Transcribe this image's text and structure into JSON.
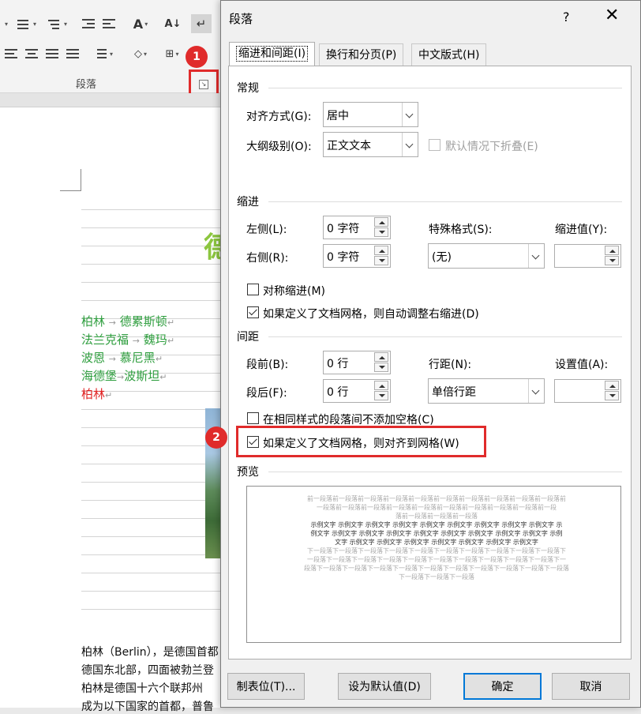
{
  "ribbon": {
    "group_label": "段落",
    "launcher_glyph": "↘",
    "icons": [
      "bullets-icon",
      "numbering-icon",
      "multilevel-list-icon",
      "decrease-indent-icon",
      "increase-indent-icon",
      "chinese-layout-icon",
      "sort-icon",
      "show-marks-icon",
      "align-left-icon",
      "align-center-icon",
      "align-right-icon",
      "justify-icon",
      "distributed-icon",
      "line-spacing-icon",
      "shading-icon",
      "borders-icon"
    ]
  },
  "callouts": {
    "one": "1",
    "two": "2"
  },
  "document": {
    "title_fragment": "德",
    "lines": [
      {
        "a": "柏林",
        "b": "德累斯顿",
        "color": "green"
      },
      {
        "a": "法兰克福",
        "b": "魏玛",
        "color": "green"
      },
      {
        "a": "波恩",
        "b": "慕尼黑",
        "color": "green"
      },
      {
        "a": "海德堡",
        "b": "波斯坦",
        "color": "green"
      },
      {
        "a": "柏林",
        "b": "",
        "color": "red"
      }
    ],
    "para_marker": "↵",
    "arrow": "→",
    "body_lines": [
      "柏林（Berlin），是德国首都",
      "德国东北部，四面被勃兰登",
      "柏林是德国十六个联邦州",
      "成为以下国家的首都，普鲁"
    ]
  },
  "dialog": {
    "title": "段落",
    "help": "?",
    "close": "✕",
    "tabs": [
      "缩进和间距(I)",
      "换行和分页(P)",
      "中文版式(H)"
    ],
    "general": {
      "heading": "常规",
      "alignment_label": "对齐方式(G):",
      "alignment_value": "居中",
      "outline_label": "大纲级别(O):",
      "outline_value": "正文文本",
      "collapse_label": "默认情况下折叠(E)"
    },
    "indent": {
      "heading": "缩进",
      "left_label": "左侧(L):",
      "left_value": "0 字符",
      "right_label": "右侧(R):",
      "right_value": "0 字符",
      "special_label": "特殊格式(S):",
      "special_value": "(无)",
      "by_label": "缩进值(Y):",
      "by_value": "",
      "mirror_label": "对称缩进(M)",
      "auto_adjust_label": "如果定义了文档网格，则自动调整右缩进(D)"
    },
    "spacing": {
      "heading": "间距",
      "before_label": "段前(B):",
      "before_value": "0 行",
      "after_label": "段后(F):",
      "after_value": "0 行",
      "line_label": "行距(N):",
      "line_value": "单倍行距",
      "at_label": "设置值(A):",
      "at_value": "",
      "no_space_label": "在相同样式的段落间不添加空格(C)",
      "snap_grid_label": "如果定义了文档网格，则对齐到网格(W)"
    },
    "preview": {
      "heading": "预览",
      "prev_lines": [
        "前一段落前一段落前一段落前一段落前一段落前一段落前一段落前一段落前一段落前一段落前",
        "一段落前一段落前一段落前一段落前一段落前一段落前一段落前一段落前一段落前一段",
        "落前一段落前一段落前一段落"
      ],
      "sample_lines": [
        "示例文字 示例文字 示例文字 示例文字 示例文字 示例文字 示例文字 示例文字 示例文字 示",
        "例文字 示例文字 示例文字 示例文字 示例文字 示例文字 示例文字 示例文字 示例文字 示例",
        "文字 示例文字 示例文字 示例文字 示例文字 示例文字 示例文字 示例文字"
      ],
      "next_lines": [
        "下一段落下一段落下一段落下一段落下一段落下一段落下一段落下一段落下一段落下一段落下",
        "一段落下一段落下一段落下一段落下一段落下一段落下一段落下一段落下一段落下一段落下一",
        "段落下一段落下一段落下一段落下一段落下一段落下一段落下一段落下一段落下一段落下一段落",
        "下一段落下一段落下一段落"
      ]
    },
    "buttons": {
      "tabs": "制表位(T)...",
      "set_default": "设为默认值(D)",
      "ok": "确定",
      "cancel": "取消"
    }
  }
}
